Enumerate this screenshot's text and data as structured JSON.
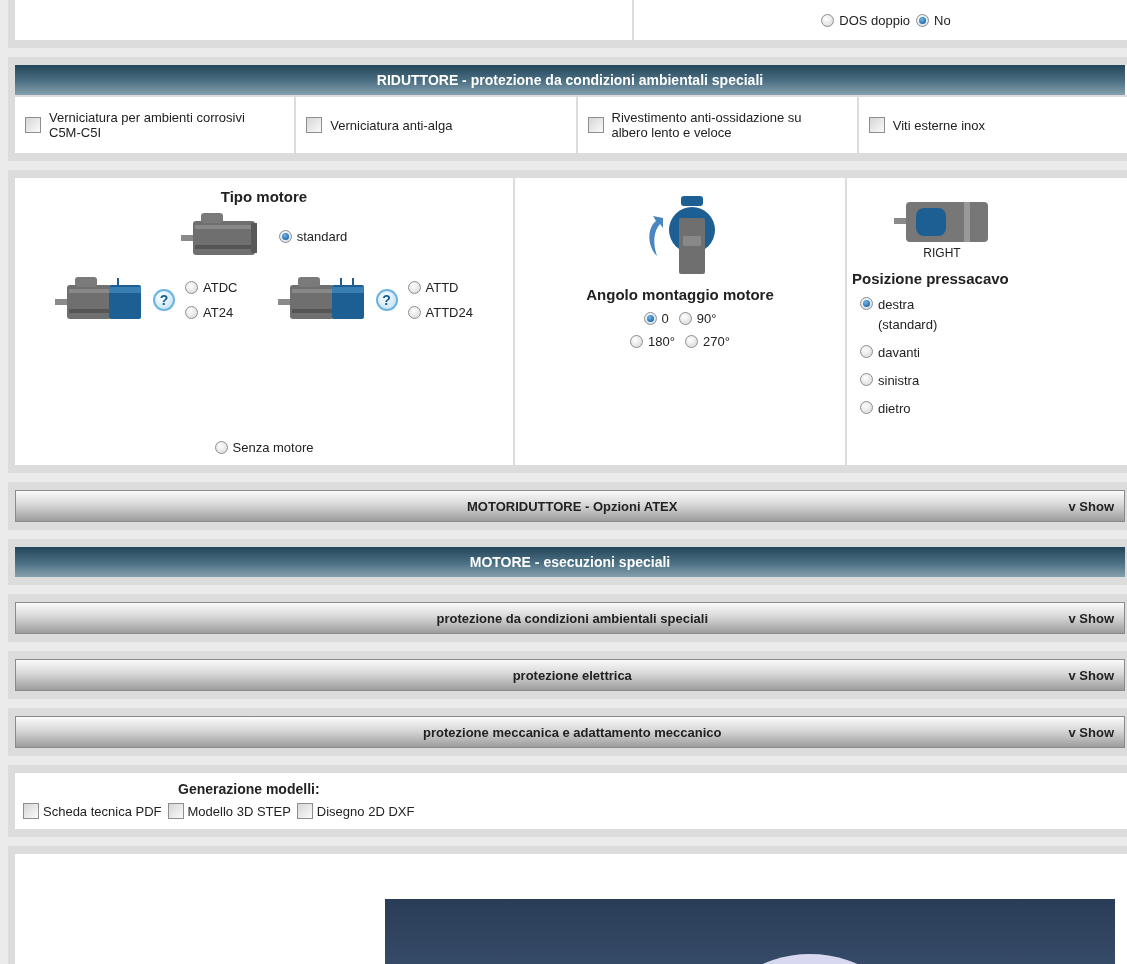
{
  "top_options": {
    "radios": [
      {
        "label": "DOS doppio",
        "selected": false
      },
      {
        "label": "No",
        "selected": true
      }
    ]
  },
  "riduttore": {
    "title": "RIDUTTORE - protezione da condizioni ambientali speciali",
    "options": [
      {
        "label": "Verniciatura per ambienti corrosivi C5M-C5I",
        "checked": false
      },
      {
        "label": "Verniciatura anti-alga",
        "checked": false
      },
      {
        "label": "Rivestimento anti-ossidazione su albero lento e veloce",
        "checked": false
      },
      {
        "label": "Viti esterne inox",
        "checked": false
      }
    ]
  },
  "tipo_motore": {
    "title": "Tipo motore",
    "standard": {
      "label": "standard",
      "selected": true
    },
    "groups": [
      {
        "options": [
          {
            "label": "ATDC",
            "selected": false
          },
          {
            "label": "AT24",
            "selected": false
          }
        ]
      },
      {
        "options": [
          {
            "label": "ATTD",
            "selected": false
          },
          {
            "label": "ATTD24",
            "selected": false
          }
        ]
      }
    ],
    "help": "?",
    "none": {
      "label": "Senza motore",
      "selected": false
    }
  },
  "angolo": {
    "title": "Angolo montaggio motore",
    "rows": [
      [
        {
          "label": "0",
          "selected": true
        },
        {
          "label": "90°",
          "selected": false
        }
      ],
      [
        {
          "label": "180°",
          "selected": false
        },
        {
          "label": "270°",
          "selected": false
        }
      ]
    ]
  },
  "pressacavo": {
    "caption": "RIGHT",
    "title": "Posizione pressacavo",
    "options": [
      {
        "label": "destra (standard)",
        "selected": true
      },
      {
        "label": "davanti",
        "selected": false
      },
      {
        "label": "sinistra",
        "selected": false
      },
      {
        "label": "dietro",
        "selected": false
      }
    ]
  },
  "sections": [
    {
      "kind": "collapsible",
      "title": "MOTORIDUTTORE - Opzioni ATEX",
      "toggle": "v Show"
    },
    {
      "kind": "header",
      "title": "MOTORE - esecuzioni speciali"
    },
    {
      "kind": "collapsible",
      "title": "protezione da condizioni ambientali speciali",
      "toggle": "v Show"
    },
    {
      "kind": "collapsible",
      "title": "protezione elettrica",
      "toggle": "v Show"
    },
    {
      "kind": "collapsible",
      "title": "protezione meccanica e adattamento meccanico",
      "toggle": "v Show"
    }
  ],
  "generazione": {
    "title": "Generazione modelli:",
    "options": [
      {
        "label": "Scheda tecnica PDF",
        "checked": false
      },
      {
        "label": "Modello 3D STEP",
        "checked": false
      },
      {
        "label": "Disegno 2D DXF",
        "checked": false
      }
    ]
  }
}
